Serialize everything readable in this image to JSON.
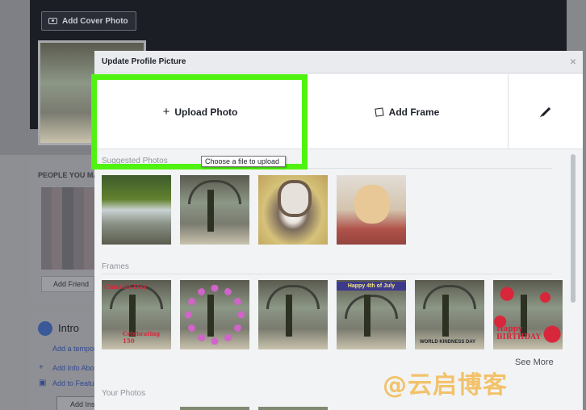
{
  "background": {
    "cover_button_label": "Add Cover Photo",
    "people_label": "PEOPLE YOU MAY KNOW",
    "add_friend_label": "Add Friend",
    "intro_title": "Intro",
    "intro_links": [
      "Add a temporary",
      "Add Info About",
      "Add to Featured"
    ],
    "intro_button": "Add Instagram"
  },
  "modal": {
    "title": "Update Profile Picture",
    "close_glyph": "×",
    "upload_label": "Upload Photo",
    "upload_icon": "plus-icon",
    "frame_label": "Add Frame",
    "frame_icon": "frame-icon",
    "edit_icon": "pencil-icon",
    "tooltip": "Choose a file to upload",
    "suggested_label": "Suggested Photos",
    "frames_label": "Frames",
    "frames": [
      {
        "caption": "Canada Day",
        "sub": "Celebrating 150"
      },
      {
        "caption": ""
      },
      {
        "caption": ""
      },
      {
        "caption": "Happy 4th of July"
      },
      {
        "caption": "WORLD KINDNESS DAY"
      },
      {
        "caption": "Happy BIRTHDAY"
      }
    ],
    "see_more": "See More",
    "your_photos_label": "Your Photos"
  },
  "watermark": "@云启博客",
  "colors": {
    "highlight": "#4ff30f",
    "modal_bg": "#f2f3f5",
    "cover": "#1c1e26"
  }
}
